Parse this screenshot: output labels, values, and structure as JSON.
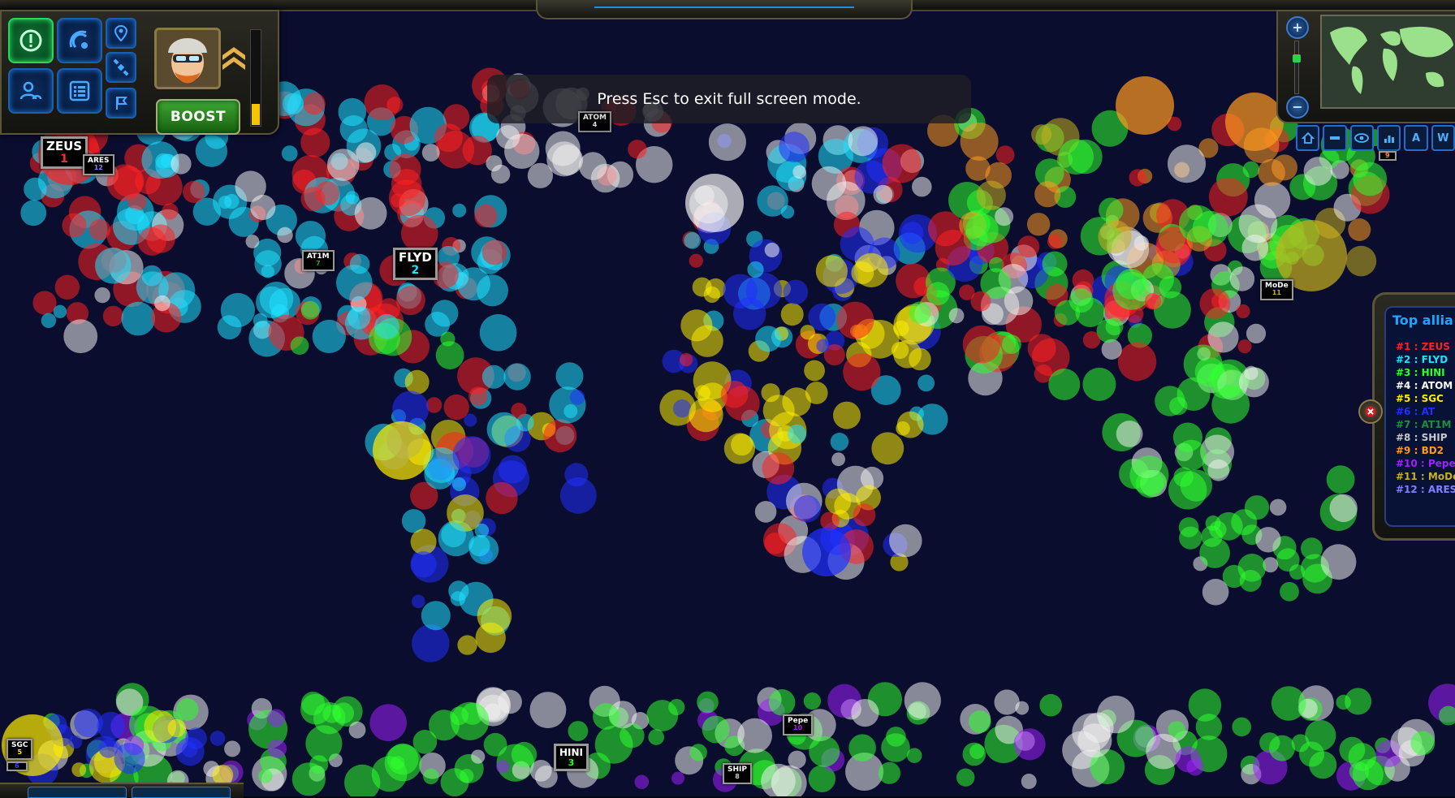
{
  "notice": {
    "text": "Press Esc to exit full screen mode."
  },
  "hud": {
    "boost_label": "BOOST",
    "xp_fraction": 0.22,
    "buttons": [
      {
        "name": "alert-icon",
        "active": true
      },
      {
        "name": "radar-icon",
        "active": false
      },
      {
        "name": "location-pin-icon",
        "active": false
      },
      {
        "name": "satellite-icon",
        "active": false
      },
      {
        "name": "users-icon",
        "active": false
      },
      {
        "name": "list-icon",
        "active": false
      },
      {
        "name": "flag-icon",
        "active": false
      }
    ]
  },
  "minimap": {
    "zoom_in": "+",
    "zoom_out": "−",
    "zoom_level": 0.7
  },
  "toolbar": {
    "buttons": [
      "home-icon",
      "move-icon",
      "eye-icon",
      "stats-icon",
      "A",
      "W"
    ]
  },
  "map_tags": [
    {
      "id": "zeus",
      "name": "ZEUS",
      "rank": "1",
      "rank_color": "#ff2a2a",
      "size": "big"
    },
    {
      "id": "ares",
      "name": "ARES",
      "rank": "12",
      "rank_color": "#8080ff",
      "size": "tiny"
    },
    {
      "id": "atom",
      "name": "ATOM",
      "rank": "4",
      "rank_color": "#ffffff",
      "size": "tiny"
    },
    {
      "id": "at1m",
      "name": "AT1M",
      "rank": "7",
      "rank_color": "#29a046",
      "size": "tiny"
    },
    {
      "id": "flyd",
      "name": "FLYD",
      "rank": "2",
      "rank_color": "#20e0ff",
      "size": "big"
    },
    {
      "id": "mode",
      "name": "MoDe",
      "rank": "11",
      "rank_color": "#c8b020",
      "size": "tiny"
    },
    {
      "id": "bd2",
      "name": "",
      "rank": "9",
      "rank_color": "#ff9a20",
      "size": "tiny"
    },
    {
      "id": "sgc",
      "name": "SGC",
      "rank": "5",
      "rank_color": "#ffee00",
      "size": "tiny"
    },
    {
      "id": "at",
      "name": "",
      "rank": "6",
      "rank_color": "#3040ff",
      "size": "tiny"
    },
    {
      "id": "hini",
      "name": "HINI",
      "rank": "3",
      "rank_color": "#30ff30",
      "size": "normal"
    },
    {
      "id": "pepe",
      "name": "Pepe",
      "rank": "10",
      "rank_color": "#a020ff",
      "size": "tiny"
    },
    {
      "id": "ship",
      "name": "SHIP",
      "rank": "8",
      "rank_color": "#c8c8c8",
      "size": "tiny"
    }
  ],
  "alliances": {
    "title": "Top allia",
    "items": [
      {
        "rank": "#1 :",
        "name": "ZEUS",
        "color": "#ff2020"
      },
      {
        "rank": "#2 :",
        "name": "FLYD",
        "color": "#20e0ff"
      },
      {
        "rank": "#3 :",
        "name": "HINI",
        "color": "#30ff30"
      },
      {
        "rank": "#4 :",
        "name": "ATOM",
        "color": "#ffffff"
      },
      {
        "rank": "#5 :",
        "name": "SGC",
        "color": "#ffee00"
      },
      {
        "rank": "#6 :",
        "name": "AT",
        "color": "#2030ff"
      },
      {
        "rank": "#7 :",
        "name": "AT1M",
        "color": "#1f8f3c"
      },
      {
        "rank": "#8 :",
        "name": "SHIP",
        "color": "#c8c8c8"
      },
      {
        "rank": "#9 :",
        "name": "BD2",
        "color": "#ff9a20"
      },
      {
        "rank": "#10 :",
        "name": "Pepe",
        "color": "#a020ff"
      },
      {
        "rank": "#11 :",
        "name": "MoDe",
        "color": "#c8b020"
      },
      {
        "rank": "#12 :",
        "name": "ARES",
        "color": "#8080ff"
      }
    ]
  },
  "colors": {
    "ocean": "#0b0d2e",
    "zeus": "#ff2020",
    "flyd": "#20e0ff",
    "hini": "#30ff30",
    "atom": "#f0f0f0",
    "sgc": "#ffee00",
    "at": "#2030ff",
    "bd2": "#ff9a20",
    "pepe": "#a020ff",
    "mode": "#c8b020"
  }
}
